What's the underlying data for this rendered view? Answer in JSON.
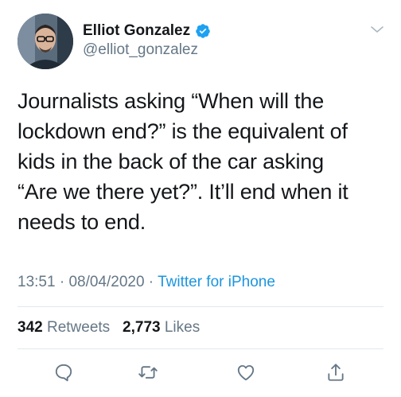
{
  "user": {
    "display_name": "Elliot Gonzalez",
    "handle": "@elliot_gonzalez",
    "verified": true
  },
  "tweet": {
    "text": "Journalists asking “When will the\nlockdown end?” is the equivalent of\nkids in the back of the car asking\n“Are we there yet?”. It’ll end when it\nneeds to end.",
    "time": "13:51",
    "separator1": " · ",
    "date": "08/04/2020",
    "separator2": " · ",
    "source": "Twitter for iPhone"
  },
  "stats": {
    "retweets_count": "342",
    "retweets_label": "Retweets",
    "likes_count": "2,773",
    "likes_label": "Likes"
  },
  "actions": [
    "reply-icon",
    "retweet-icon",
    "like-icon",
    "share-icon"
  ],
  "colors": {
    "text": "#14171a",
    "secondary": "#657786",
    "link": "#1b95e0",
    "verified": "#1da1f2",
    "divider": "#e1e8ed"
  }
}
